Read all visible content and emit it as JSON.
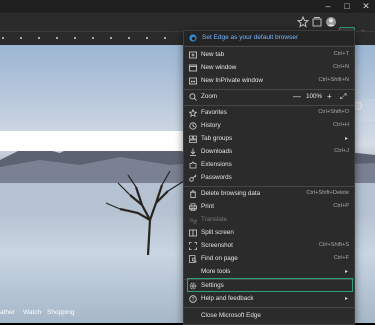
{
  "browser": {
    "window_controls": [
      "–",
      "□",
      "✕"
    ],
    "more_label": "···",
    "profile_label": "Ov"
  },
  "menu": {
    "banner": "Set Edge as your default browser",
    "items": [
      {
        "label": "New tab",
        "shortcut": "Ctrl+T"
      },
      {
        "label": "New window",
        "shortcut": "Ctrl+N"
      },
      {
        "label": "New InPrivate window",
        "shortcut": "Ctrl+Shift+N"
      },
      {
        "label": "Zoom",
        "shortcut": ""
      },
      {
        "label": "Favorites",
        "shortcut": "Ctrl+Shift+O"
      },
      {
        "label": "History",
        "shortcut": "Ctrl+H"
      },
      {
        "label": "Tab groups",
        "shortcut": ""
      },
      {
        "label": "Downloads",
        "shortcut": "Ctrl+J"
      },
      {
        "label": "Extensions",
        "shortcut": ""
      },
      {
        "label": "Passwords",
        "shortcut": ""
      },
      {
        "label": "Delete browsing data",
        "shortcut": "Ctrl+Shift+Delete"
      },
      {
        "label": "Print",
        "shortcut": "Ctrl+P"
      },
      {
        "label": "Translate",
        "shortcut": ""
      },
      {
        "label": "Split screen",
        "shortcut": ""
      },
      {
        "label": "Screenshot",
        "shortcut": "Ctrl+Shift+S"
      },
      {
        "label": "Find on page",
        "shortcut": "Ctrl+F"
      },
      {
        "label": "More tools",
        "shortcut": ""
      },
      {
        "label": "Settings",
        "shortcut": ""
      },
      {
        "label": "Help and feedback",
        "shortcut": ""
      },
      {
        "label": "Close Microsoft Edge",
        "shortcut": ""
      }
    ],
    "zoom": {
      "value": "100%",
      "minus": "—",
      "plus": "+",
      "fullscreen": "⤢"
    }
  },
  "page": {
    "bottom_links": [
      "ather",
      "Watch",
      "Shopping"
    ]
  },
  "colors": {
    "accent": "#2fa27b",
    "link": "#79b6ff"
  }
}
